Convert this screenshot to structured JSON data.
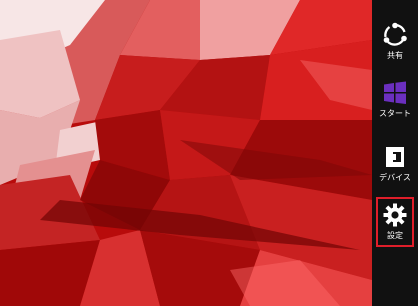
{
  "charms": [
    {
      "id": "share",
      "label": "共有",
      "icon": "share-icon"
    },
    {
      "id": "start",
      "label": "スタート",
      "icon": "windows-logo-icon",
      "accent": "#6b2fbf"
    },
    {
      "id": "devices",
      "label": "デバイス",
      "icon": "devices-icon"
    },
    {
      "id": "settings",
      "label": "設定",
      "icon": "gear-icon",
      "selected": true,
      "highlight_color": "#e01e2a"
    }
  ],
  "colors": {
    "charm_bar_background": "#111111",
    "charm_text": "#ffffff",
    "wallpaper_base": "#b10808"
  }
}
